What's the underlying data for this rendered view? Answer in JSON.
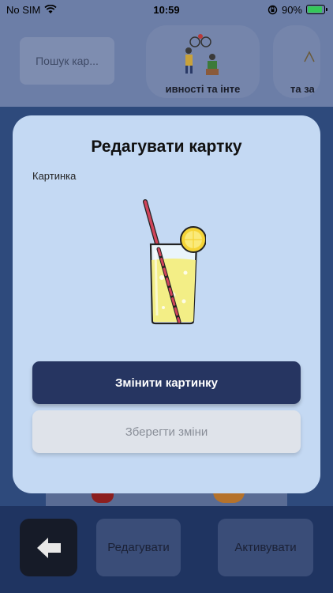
{
  "status_bar": {
    "carrier": "No SIM",
    "time": "10:59",
    "battery_percent": "90%",
    "battery_level": 0.9,
    "icons": [
      "wifi-icon",
      "orientation-lock-icon",
      "battery-icon"
    ]
  },
  "background": {
    "search_placeholder": "Пошук кар...",
    "categories": [
      {
        "label": "ивності та інте",
        "icon": "people-activities-icon"
      },
      {
        "label": "та за",
        "icon": "category-icon"
      }
    ],
    "bottom_bar": {
      "back_icon": "arrow-left-icon",
      "edit_label": "Редагувати",
      "activate_label": "Активувати"
    }
  },
  "modal": {
    "title": "Редагувати картку",
    "image_label": "Картинка",
    "image_icon": "lemonade-glass-icon",
    "change_image_label": "Змінити картинку",
    "save_label": "Зберегти зміни"
  },
  "colors": {
    "primary": "#263561",
    "modal_bg": "#c4d9f3",
    "disabled_bg": "#dfe3ea",
    "disabled_text": "#8a8f99"
  }
}
